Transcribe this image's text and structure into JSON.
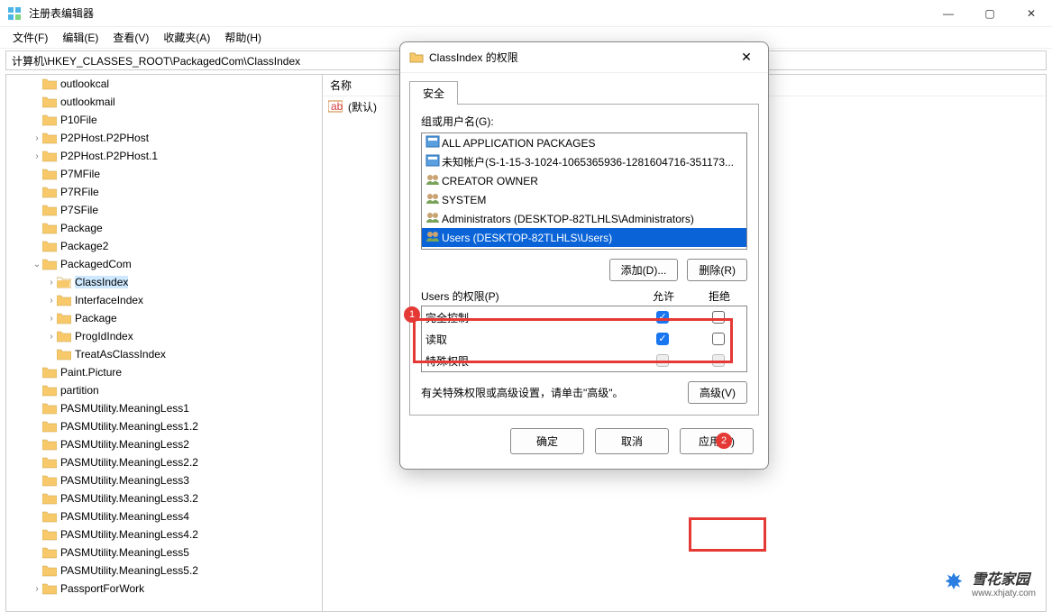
{
  "window": {
    "title": "注册表编辑器",
    "min": "—",
    "max": "▢",
    "close": "✕"
  },
  "menu": {
    "file": "文件(F)",
    "edit": "编辑(E)",
    "view": "查看(V)",
    "fav": "收藏夹(A)",
    "help": "帮助(H)"
  },
  "path": "计算机\\HKEY_CLASSES_ROOT\\PackagedCom\\ClassIndex",
  "tree": [
    {
      "d": 2,
      "e": "",
      "l": "outlookcal"
    },
    {
      "d": 2,
      "e": "",
      "l": "outlookmail"
    },
    {
      "d": 2,
      "e": "",
      "l": "P10File"
    },
    {
      "d": 2,
      "e": ">",
      "l": "P2PHost.P2PHost"
    },
    {
      "d": 2,
      "e": ">",
      "l": "P2PHost.P2PHost.1"
    },
    {
      "d": 2,
      "e": "",
      "l": "P7MFile"
    },
    {
      "d": 2,
      "e": "",
      "l": "P7RFile"
    },
    {
      "d": 2,
      "e": "",
      "l": "P7SFile"
    },
    {
      "d": 2,
      "e": "",
      "l": "Package"
    },
    {
      "d": 2,
      "e": "",
      "l": "Package2"
    },
    {
      "d": 2,
      "e": "v",
      "l": "PackagedCom"
    },
    {
      "d": 3,
      "e": ">",
      "l": "ClassIndex",
      "sel": true
    },
    {
      "d": 3,
      "e": ">",
      "l": "InterfaceIndex"
    },
    {
      "d": 3,
      "e": ">",
      "l": "Package"
    },
    {
      "d": 3,
      "e": ">",
      "l": "ProgIdIndex"
    },
    {
      "d": 3,
      "e": "",
      "l": "TreatAsClassIndex"
    },
    {
      "d": 2,
      "e": "",
      "l": "Paint.Picture"
    },
    {
      "d": 2,
      "e": "",
      "l": "partition"
    },
    {
      "d": 2,
      "e": "",
      "l": "PASMUtility.MeaningLess1"
    },
    {
      "d": 2,
      "e": "",
      "l": "PASMUtility.MeaningLess1.2"
    },
    {
      "d": 2,
      "e": "",
      "l": "PASMUtility.MeaningLess2"
    },
    {
      "d": 2,
      "e": "",
      "l": "PASMUtility.MeaningLess2.2"
    },
    {
      "d": 2,
      "e": "",
      "l": "PASMUtility.MeaningLess3"
    },
    {
      "d": 2,
      "e": "",
      "l": "PASMUtility.MeaningLess3.2"
    },
    {
      "d": 2,
      "e": "",
      "l": "PASMUtility.MeaningLess4"
    },
    {
      "d": 2,
      "e": "",
      "l": "PASMUtility.MeaningLess4.2"
    },
    {
      "d": 2,
      "e": "",
      "l": "PASMUtility.MeaningLess5"
    },
    {
      "d": 2,
      "e": "",
      "l": "PASMUtility.MeaningLess5.2"
    },
    {
      "d": 2,
      "e": ">",
      "l": "PassportForWork"
    }
  ],
  "detail": {
    "nameHdr": "名称",
    "default": "(默认)"
  },
  "dialog": {
    "title": "ClassIndex 的权限",
    "tab": "安全",
    "groupsHdr": "组或用户名(G):",
    "groups": [
      {
        "i": "pkg",
        "t": "ALL APPLICATION PACKAGES"
      },
      {
        "i": "pkg",
        "t": "未知帐户(S-1-15-3-1024-1065365936-1281604716-351173..."
      },
      {
        "i": "grp",
        "t": "CREATOR OWNER"
      },
      {
        "i": "grp",
        "t": "SYSTEM"
      },
      {
        "i": "grp",
        "t": "Administrators (DESKTOP-82TLHLS\\Administrators)"
      },
      {
        "i": "grp",
        "t": "Users (DESKTOP-82TLHLS\\Users)",
        "sel": true
      }
    ],
    "add": "添加(D)...",
    "remove": "删除(R)",
    "permHdr": "Users 的权限(P)",
    "allow": "允许",
    "deny": "拒绝",
    "perms": [
      {
        "n": "完全控制",
        "a": true,
        "d": false
      },
      {
        "n": "读取",
        "a": true,
        "d": false
      },
      {
        "n": "特殊权限",
        "a": false,
        "d": false,
        "dis": true
      }
    ],
    "advtxt": "有关特殊权限或高级设置，请单击\"高级\"。",
    "adv": "高级(V)",
    "ok": "确定",
    "cancel": "取消",
    "apply": "应用(A)"
  },
  "annot": {
    "b1": "1",
    "b2": "2"
  },
  "wm": {
    "t1": "雪花家园",
    "t2": "www.xhjaty.com"
  }
}
